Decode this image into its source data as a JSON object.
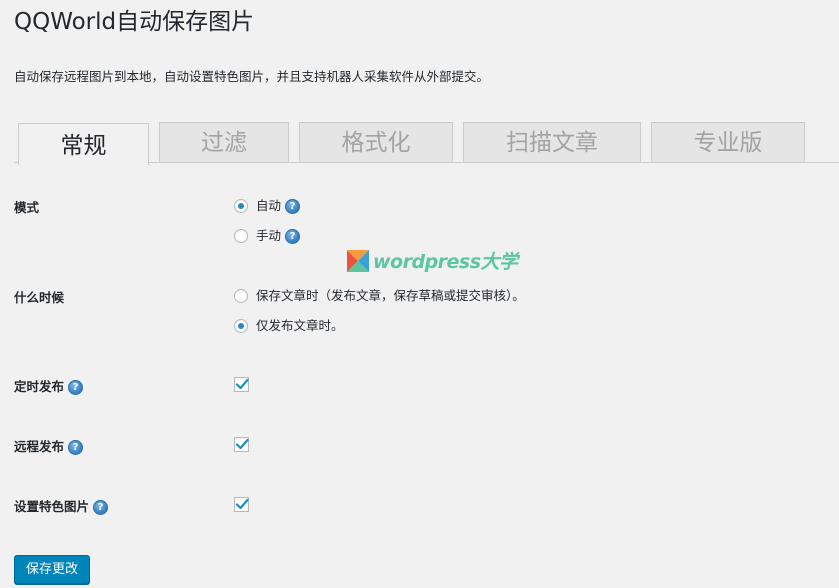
{
  "page": {
    "title": "QQWorld自动保存图片",
    "description": "自动保存远程图片到本地，自动设置特色图片，并且支持机器人采集软件从外部提交。"
  },
  "tabs": [
    {
      "label": "常规",
      "active": true
    },
    {
      "label": "过滤",
      "active": false
    },
    {
      "label": "格式化",
      "active": false
    },
    {
      "label": "扫描文章",
      "active": false
    },
    {
      "label": "专业版",
      "active": false
    }
  ],
  "settings": {
    "mode": {
      "label": "模式",
      "options": [
        {
          "label": "自动",
          "checked": true
        },
        {
          "label": "手动",
          "checked": false
        }
      ]
    },
    "when": {
      "label": "什么时候",
      "options": [
        {
          "label": "保存文章时（发布文章，保存草稿或提交审核）。",
          "checked": false
        },
        {
          "label": "仅发布文章时。",
          "checked": true
        }
      ]
    },
    "scheduled_publish": {
      "label": "定时发布",
      "checked": true
    },
    "remote_publish": {
      "label": "远程发布",
      "checked": true
    },
    "featured_image": {
      "label": "设置特色图片",
      "checked": true
    }
  },
  "help_icon": {
    "name": "help-icon",
    "glyph": "?"
  },
  "save_button": {
    "label": "保存更改"
  },
  "watermark": {
    "text": "wordpress大学"
  },
  "colors": {
    "accent": "#0085ba",
    "radio_dot": "#1e8cbe",
    "checkmark": "#1e8cbe",
    "watermark_green": "#5cc6a0",
    "watermark_orange": "#f39c3c",
    "watermark_red": "#e8543c",
    "watermark_blue": "#3ca0d8"
  }
}
